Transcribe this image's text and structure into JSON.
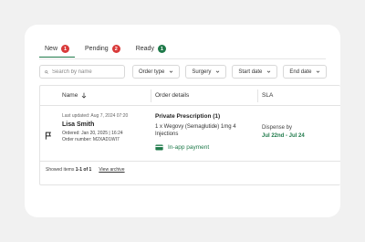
{
  "tabs": [
    {
      "label": "New",
      "count": "1",
      "active": true
    },
    {
      "label": "Pending",
      "count": "2",
      "active": false
    },
    {
      "label": "Ready",
      "count": "1",
      "active": false
    }
  ],
  "search": {
    "placeholder": "Search by name"
  },
  "filters": [
    {
      "label": "Order type"
    },
    {
      "label": "Surgery"
    },
    {
      "label": "Start date"
    },
    {
      "label": "End date"
    }
  ],
  "table": {
    "headers": {
      "name": "Name",
      "order_details": "Order details",
      "sla": "SLA"
    },
    "rows": [
      {
        "last_updated": "Last updated: Aug 7, 2024 07:20",
        "patient_name": "Lisa Smith",
        "ordered_label": "Ordered:",
        "ordered_value": "Jan 20, 2025 | 16:24",
        "order_number_label": "Order number:",
        "order_number_value": "M2XAD1WI7",
        "prescription_title": "Private Prescription (1)",
        "prescription_item_line1": "1 x Wegovy (Semaglutide) 1mg 4",
        "prescription_item_line2": "Injections",
        "payment": "In-app payment",
        "sla_label": "Dispense by",
        "sla_dates": "Jul 22nd - Jul 24"
      }
    ]
  },
  "footer": {
    "showing_label": "Showed items",
    "showing_range": "1-1 of 1",
    "view_link": "View archive"
  },
  "colors": {
    "accent": "#1f7a4a",
    "badge_red": "#d93a3a",
    "badge_green": "#1f7a4a"
  }
}
